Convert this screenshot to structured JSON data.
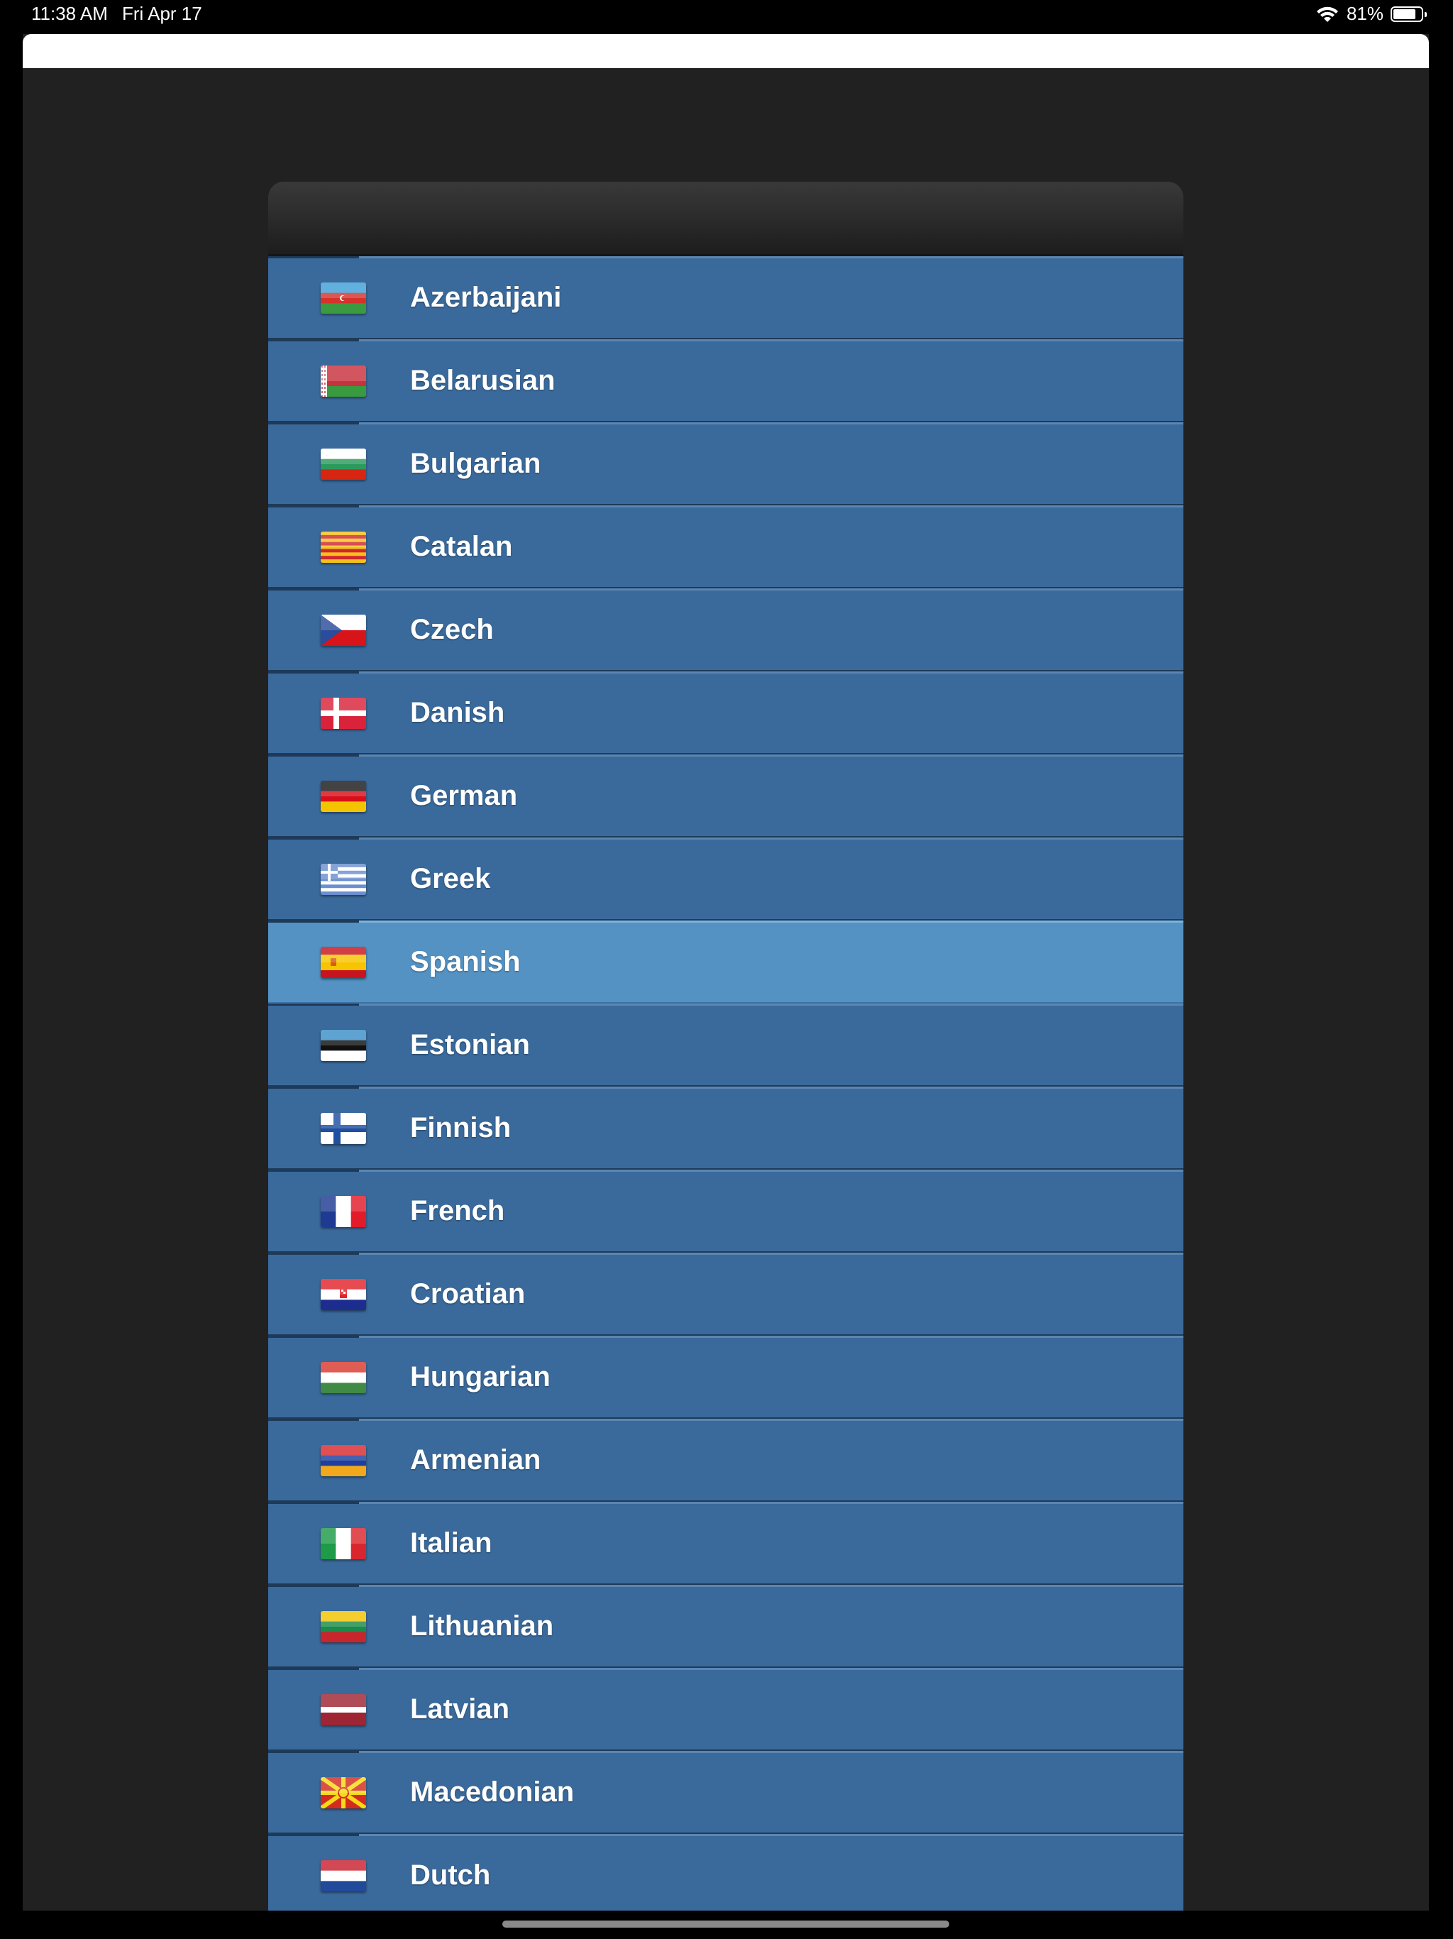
{
  "status_bar": {
    "time": "11:38 AM",
    "date": "Fri Apr 17",
    "battery": "81%",
    "battery_level": 0.81
  },
  "colors": {
    "list_row": "#3a6a9c",
    "list_row_selected": "#5492c4",
    "background": "#212121"
  },
  "languages": [
    {
      "label": "Azerbaijani",
      "flag": "azerbaijan-flag-icon",
      "selected": false
    },
    {
      "label": "Belarusian",
      "flag": "belarus-flag-icon",
      "selected": false
    },
    {
      "label": "Bulgarian",
      "flag": "bulgaria-flag-icon",
      "selected": false
    },
    {
      "label": "Catalan",
      "flag": "catalonia-flag-icon",
      "selected": false
    },
    {
      "label": "Czech",
      "flag": "czech-flag-icon",
      "selected": false
    },
    {
      "label": "Danish",
      "flag": "denmark-flag-icon",
      "selected": false
    },
    {
      "label": "German",
      "flag": "germany-flag-icon",
      "selected": false
    },
    {
      "label": "Greek",
      "flag": "greece-flag-icon",
      "selected": false
    },
    {
      "label": "Spanish",
      "flag": "spain-flag-icon",
      "selected": true
    },
    {
      "label": "Estonian",
      "flag": "estonia-flag-icon",
      "selected": false
    },
    {
      "label": "Finnish",
      "flag": "finland-flag-icon",
      "selected": false
    },
    {
      "label": "French",
      "flag": "france-flag-icon",
      "selected": false
    },
    {
      "label": "Croatian",
      "flag": "croatia-flag-icon",
      "selected": false
    },
    {
      "label": "Hungarian",
      "flag": "hungary-flag-icon",
      "selected": false
    },
    {
      "label": "Armenian",
      "flag": "armenia-flag-icon",
      "selected": false
    },
    {
      "label": "Italian",
      "flag": "italy-flag-icon",
      "selected": false
    },
    {
      "label": "Lithuanian",
      "flag": "lithuania-flag-icon",
      "selected": false
    },
    {
      "label": "Latvian",
      "flag": "latvia-flag-icon",
      "selected": false
    },
    {
      "label": "Macedonian",
      "flag": "macedonia-flag-icon",
      "selected": false
    },
    {
      "label": "Dutch",
      "flag": "netherlands-flag-icon",
      "selected": false
    },
    {
      "label": "",
      "flag": "partial-flag-icon",
      "selected": false
    }
  ]
}
